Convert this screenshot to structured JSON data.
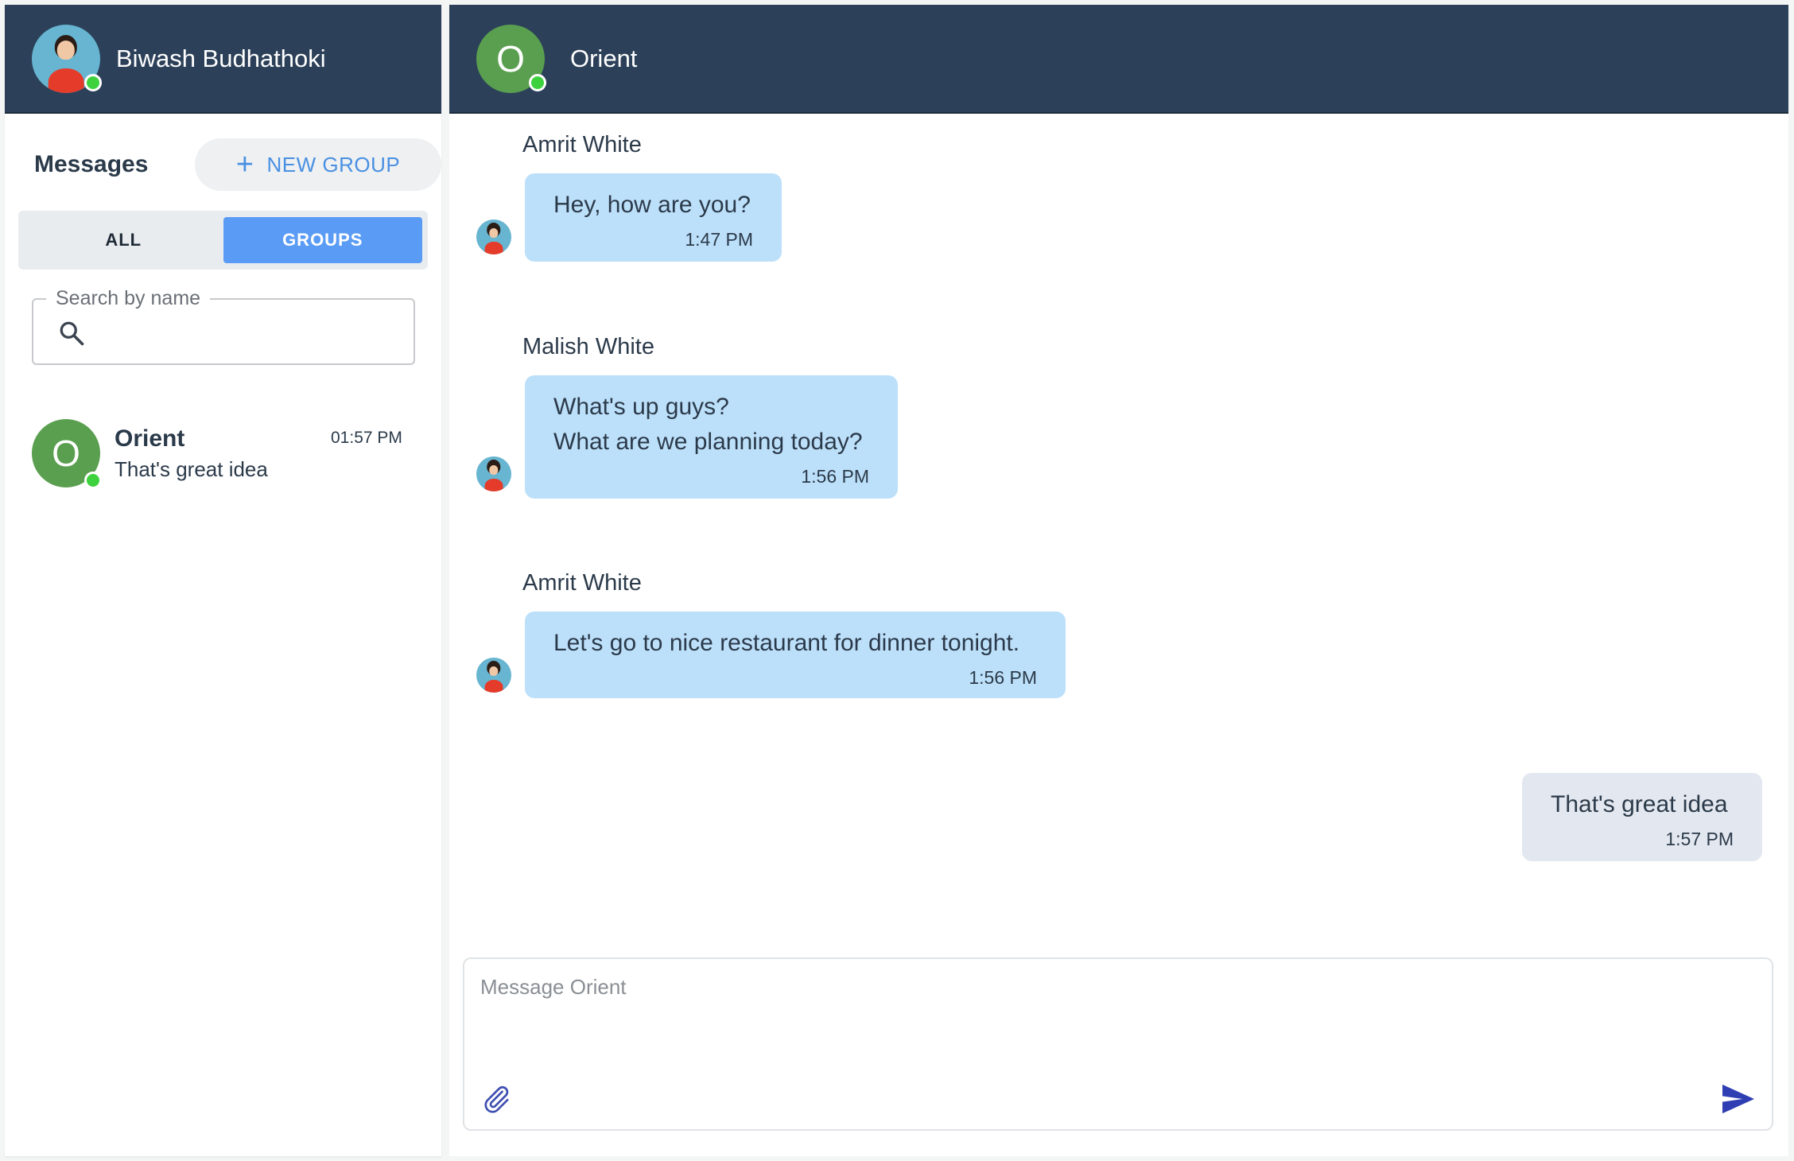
{
  "sidebar": {
    "user_name": "Biwash Budhathoki",
    "messages_title": "Messages",
    "new_group_label": "NEW GROUP",
    "tabs": [
      {
        "label": "ALL",
        "active": false
      },
      {
        "label": "GROUPS",
        "active": true
      }
    ],
    "search": {
      "legend": "Search by name",
      "value": ""
    },
    "conversations": [
      {
        "initial": "O",
        "name": "Orient",
        "time": "01:57 PM",
        "preview": "That's great idea",
        "online": true
      }
    ]
  },
  "chat": {
    "title": "Orient",
    "initial": "O",
    "messages": [
      {
        "sender": "Amrit White",
        "text": "Hey, how are you?",
        "time": "1:47 PM",
        "mine": false
      },
      {
        "sender": "Malish White",
        "text": "What's up guys?\nWhat are we planning today?",
        "time": "1:56 PM",
        "mine": false
      },
      {
        "sender": "Amrit White",
        "text": "Let's go to nice restaurant for dinner tonight.",
        "time": "1:56 PM",
        "mine": false
      },
      {
        "sender": "",
        "text": "That's great idea",
        "time": "1:57 PM",
        "mine": true
      }
    ],
    "composer_placeholder": "Message Orient"
  },
  "colors": {
    "header_bg": "#2c4159",
    "accent": "#5a9cf5",
    "online": "#3ed13e",
    "incoming_bubble": "#bde0fa",
    "outgoing_bubble": "#e3e7ef",
    "group_avatar": "#5a9f4f"
  }
}
